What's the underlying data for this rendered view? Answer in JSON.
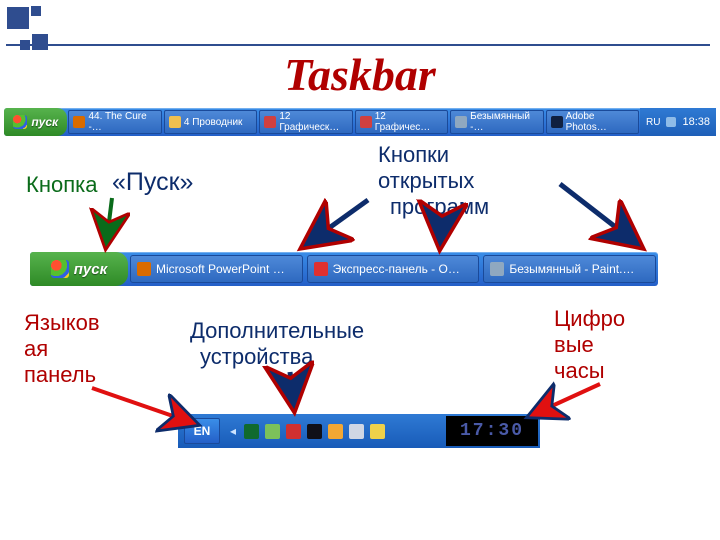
{
  "title": "Taskbar",
  "top_taskbar": {
    "start_label": "пуск",
    "tasks": [
      {
        "icon_color": "#d96b00",
        "label": "44. The Cure -…"
      },
      {
        "icon_color": "#f0c050",
        "label": "4 Проводник"
      },
      {
        "icon_color": "#d04040",
        "label": "12 Графическ…"
      },
      {
        "icon_color": "#d04040",
        "label": "12 Графичес…"
      },
      {
        "icon_color": "#8fa8c0",
        "label": "Безымянный -…"
      },
      {
        "icon_color": "#102040",
        "label": "Adobe Photos…"
      }
    ],
    "tray_lang": "RU",
    "tray_time": "18:38"
  },
  "labels": {
    "start_btn_1": "Кнопка",
    "start_btn_2": "«Пуск»",
    "open_programs_1": "Кнопки",
    "open_programs_2": "открытых",
    "open_programs_3": "программ",
    "lang_panel_1": "Языков",
    "lang_panel_2": "ая",
    "lang_panel_3": "панель",
    "extra_devices_1": "Дополнительные",
    "extra_devices_2": "устройства",
    "clock_1": "Цифро",
    "clock_2": "вые",
    "clock_3": "часы"
  },
  "mid_taskbar": {
    "start_label": "пуск",
    "tasks": [
      {
        "icon_color": "#d96b00",
        "label": "Microsoft PowerPoint …"
      },
      {
        "icon_color": "#e03030",
        "label": "Экспресс-панель - O…"
      },
      {
        "icon_color": "#8fa8c0",
        "label": "Безымянный - Paint.…"
      }
    ]
  },
  "bottom_tray": {
    "lang": "EN",
    "icon_colors": [
      "#106a2e",
      "#7cc15a",
      "#d03030",
      "#101018",
      "#f2a733",
      "#cfd7e4",
      "#efd14a"
    ],
    "clock": "17:30"
  }
}
